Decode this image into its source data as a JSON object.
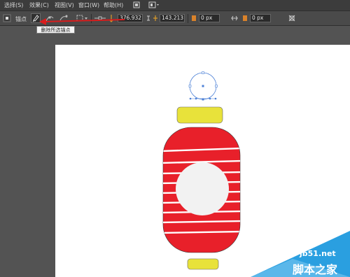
{
  "menu": {
    "items": [
      "选择(S)",
      "效果(C)",
      "视图(V)",
      "窗口(W)",
      "帮助(H)"
    ]
  },
  "controlbar": {
    "anchor_label": "锚点",
    "x_value": "376.932",
    "y_value": "143.213",
    "w_value": "0 px",
    "h_value": "0 px"
  },
  "tooltip": {
    "text": "删除所选锚点"
  },
  "colors": {
    "lantern_red": "#e8202a",
    "cap_yellow": "#e8e23a",
    "center_gray": "#f2f2f2",
    "arrow_red": "#d81c1c",
    "selection_blue": "#4a7fd6",
    "watermark_blue": "#2a9fe0"
  },
  "icons": [
    "convert-anchor-icon",
    "delete-anchor-icon",
    "anchor-handle-icon",
    "cut-path-icon",
    "align-icon",
    "transform-icon"
  ],
  "watermark": {
    "site": "jb51.net",
    "brand": "脚本之家"
  }
}
